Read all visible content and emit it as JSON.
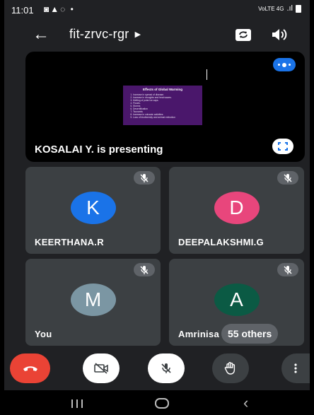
{
  "status_bar": {
    "time": "11:01",
    "icons": "◙▲◌ •",
    "network": "VoLTE 4G",
    "signal": ".ıl"
  },
  "app_bar": {
    "title": "fit-zrvc-rgr",
    "title_caret": "▶"
  },
  "presentation": {
    "slide_title": "Effects of Global Warming",
    "slide_points": [
      "Increase in spread of disease.",
      "Increase in droughts and heat waves.",
      "Melting of polar ice caps.",
      "Floods.",
      "Storms",
      "Desertification",
      "Tsunamis",
      "Increase in volcanic activities",
      "Loss of biodiversity and animal extinction"
    ],
    "presenter_label": "KOSALAI  Y. is presenting"
  },
  "participants": [
    {
      "initial": "K",
      "name": "KEERTHANA.R",
      "color": "#1a73e8"
    },
    {
      "initial": "D",
      "name": "DEEPALAKSHMI.G",
      "color": "#e8467c"
    },
    {
      "initial": "M",
      "name": "You",
      "color": "#7b96a3"
    },
    {
      "initial": "A",
      "name": "Amrinisa",
      "color": "#0b5a44"
    }
  ],
  "others_chip": "55 others",
  "colors": {
    "end_call": "#ea4335",
    "accent": "#1a73e8",
    "tile_bg": "#3c4043",
    "screen_bg": "#202124"
  }
}
